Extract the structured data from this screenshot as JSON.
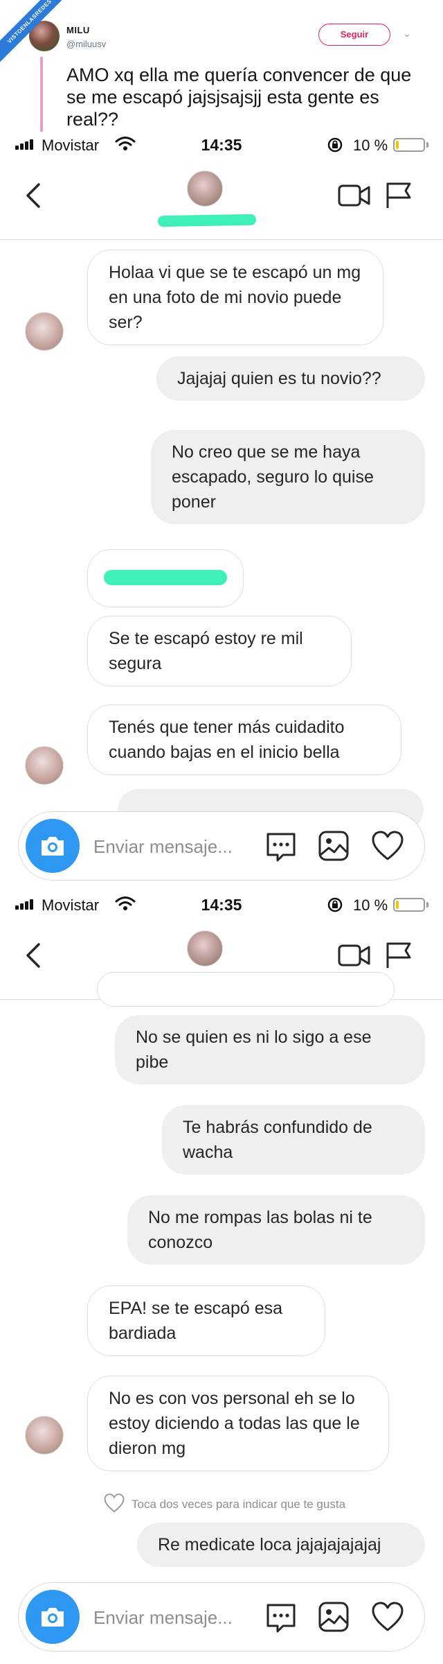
{
  "tweet": {
    "ribbon_text": "VISTOENLASREDES",
    "author_name": "MILU",
    "author_handle": "@miluusv",
    "follow_label": "Seguir",
    "text": "AMO xq ella me quería convencer de que se me escapó jajsjsajsjj esta gente es real??"
  },
  "status_bar": {
    "carrier": "Movistar",
    "time": "14:35",
    "battery": "10 %",
    "battery_level": 0.1
  },
  "composer": {
    "placeholder": "Enviar mensaje..."
  },
  "screen1": {
    "messages": [
      {
        "side": "in",
        "text": "Holaa vi que se te escapó un mg en una foto de mi novio puede ser?"
      },
      {
        "side": "out",
        "text": "Jajajaj quien es tu novio??"
      },
      {
        "side": "out",
        "text": "No creo que se me haya escapado, seguro lo quise poner"
      },
      {
        "side": "in",
        "text": ""
      },
      {
        "side": "in",
        "text": "Se te escapó estoy re mil segura"
      },
      {
        "side": "in",
        "text": "Tenés que tener más cuidadito cuando bajas en el inicio bella"
      }
    ]
  },
  "screen2": {
    "messages": [
      {
        "side": "out",
        "text": "No se quien es ni lo sigo a ese pibe"
      },
      {
        "side": "out",
        "text": "Te habrás confundido de wacha"
      },
      {
        "side": "out",
        "text": "No me rompas las bolas ni te conozco"
      },
      {
        "side": "in",
        "text": "EPA! se te escapó esa bardiada"
      },
      {
        "side": "in",
        "text": "No es con vos personal eh se lo estoy diciendo a todas las que le dieron mg"
      },
      {
        "side": "out",
        "text": "Re medicate loca jajajajajajaj"
      }
    ],
    "like_hint": "Toca dos veces para indicar que te gusta"
  },
  "colors": {
    "scribble": "#3ef0b8",
    "camera": "#2f98f3",
    "follow": "#e0245e",
    "battery": "#f5c400"
  },
  "icons": [
    "back-icon",
    "video-call-icon",
    "flag-icon",
    "camera-icon",
    "chat-bubble-icon",
    "gallery-icon",
    "heart-icon",
    "signal-icon",
    "wifi-icon",
    "lock-rotation-icon",
    "battery-icon",
    "chevron-down-icon"
  ]
}
